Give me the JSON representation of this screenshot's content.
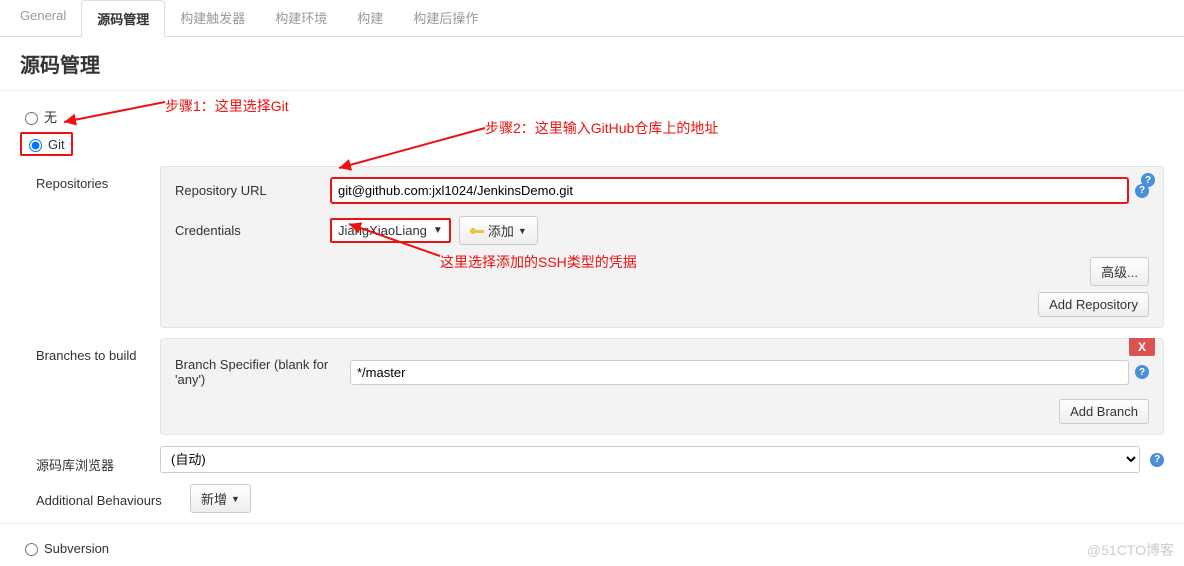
{
  "tabs": {
    "general": "General",
    "scm": "源码管理",
    "triggers": "构建触发器",
    "env": "构建环境",
    "build": "构建",
    "post": "构建后操作"
  },
  "section_title": "源码管理",
  "scm_options": {
    "none": "无",
    "git": "Git",
    "subversion": "Subversion"
  },
  "repositories": {
    "label": "Repositories",
    "url_label": "Repository URL",
    "url_value": "git@github.com:jxl1024/JenkinsDemo.git",
    "credentials_label": "Credentials",
    "credentials_value": "JiangXiaoLiang",
    "add_label": "添加",
    "advanced": "高级...",
    "add_repo": "Add Repository"
  },
  "branches": {
    "label": "Branches to build",
    "specifier_label": "Branch Specifier (blank for 'any')",
    "specifier_value": "*/master",
    "add_branch": "Add Branch"
  },
  "repo_browser": {
    "label": "源码库浏览器",
    "value": "(自动)"
  },
  "additional": {
    "label": "Additional Behaviours",
    "button": "新增"
  },
  "annotations": {
    "step1": "步骤1：这里选择Git",
    "step2": "步骤2：这里输入GitHub仓库上的地址",
    "cred_note": "这里选择添加的SSH类型的凭据"
  },
  "watermark": "@51CTO博客"
}
